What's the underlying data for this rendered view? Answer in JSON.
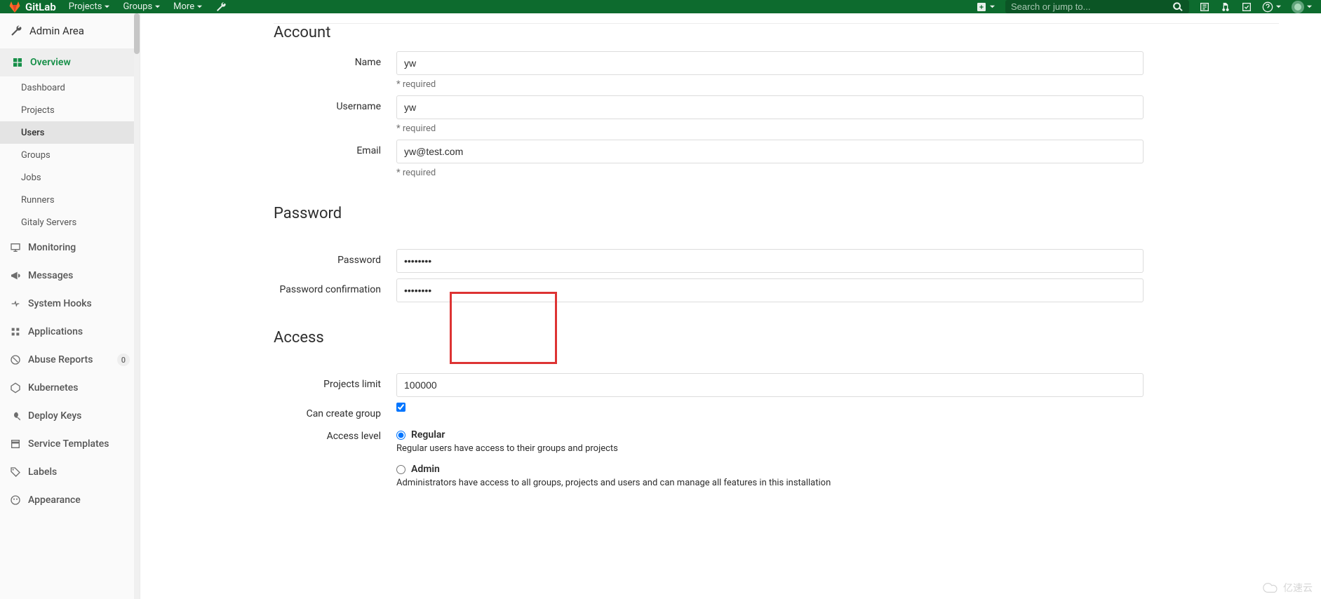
{
  "brand": "GitLab",
  "top_menu": {
    "projects": "Projects",
    "groups": "Groups",
    "more": "More"
  },
  "search": {
    "placeholder": "Search or jump to..."
  },
  "sidebar": {
    "title": "Admin Area",
    "overview": "Overview",
    "sub": {
      "dashboard": "Dashboard",
      "projects": "Projects",
      "users": "Users",
      "groups": "Groups",
      "jobs": "Jobs",
      "runners": "Runners",
      "gitaly": "Gitaly Servers"
    },
    "monitoring": "Monitoring",
    "messages": "Messages",
    "system_hooks": "System Hooks",
    "applications": "Applications",
    "abuse_reports": {
      "label": "Abuse Reports",
      "count": "0"
    },
    "kubernetes": "Kubernetes",
    "deploy_keys": "Deploy Keys",
    "service_templates": "Service Templates",
    "labels": "Labels",
    "appearance": "Appearance"
  },
  "form": {
    "account": {
      "legend": "Account",
      "name_label": "Name",
      "name_value": "yw",
      "name_help": "* required",
      "username_label": "Username",
      "username_value": "yw",
      "username_help": "* required",
      "email_label": "Email",
      "email_value": "yw@test.com",
      "email_help": "* required"
    },
    "password": {
      "legend": "Password",
      "pw_label": "Password",
      "pw_value": "••••••••",
      "pwc_label": "Password confirmation",
      "pwc_value": "••••••••"
    },
    "access": {
      "legend": "Access",
      "projects_limit_label": "Projects limit",
      "projects_limit_value": "100000",
      "can_create_group_label": "Can create group",
      "access_level_label": "Access level",
      "regular_label": "Regular",
      "regular_desc": "Regular users have access to their groups and projects",
      "admin_label": "Admin",
      "admin_desc": "Administrators have access to all groups, projects and users and can manage all features in this installation"
    }
  },
  "watermark": "亿速云"
}
